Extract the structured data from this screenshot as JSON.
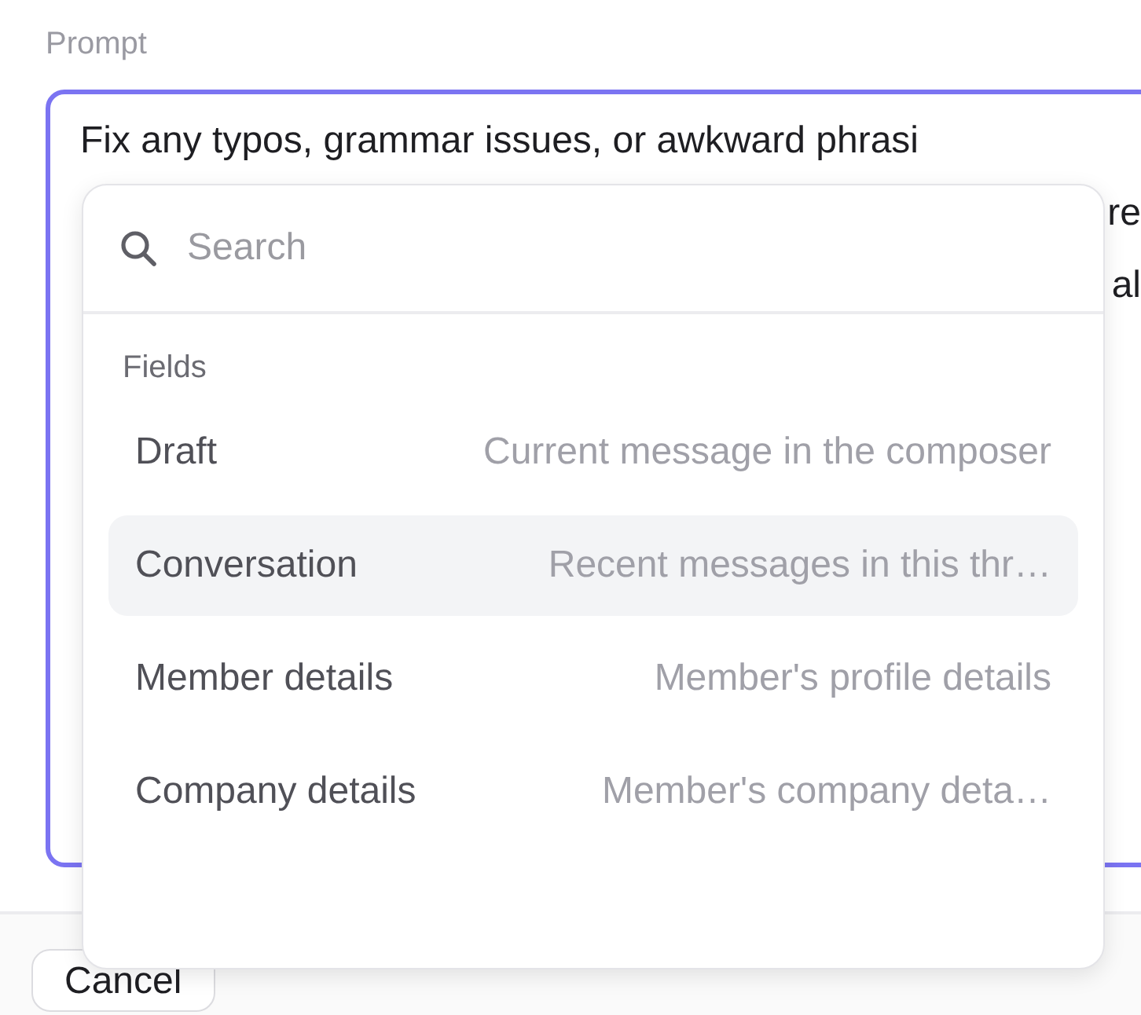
{
  "prompt": {
    "label": "Prompt",
    "lines": [
      "Fix any typos, grammar issues, or awkward phrasi",
      "re",
      "al"
    ]
  },
  "popup": {
    "search": {
      "placeholder": "Search"
    },
    "section": "Fields",
    "items": [
      {
        "name": "Draft",
        "description": "Current message in the composer",
        "selected": false
      },
      {
        "name": "Conversation",
        "description": "Recent messages in this thr…",
        "selected": true
      },
      {
        "name": "Member details",
        "description": "Member's profile details",
        "selected": false
      },
      {
        "name": "Company details",
        "description": "Member's company deta…",
        "selected": false
      }
    ]
  },
  "footer": {
    "buttons": [
      "Cancel"
    ]
  }
}
